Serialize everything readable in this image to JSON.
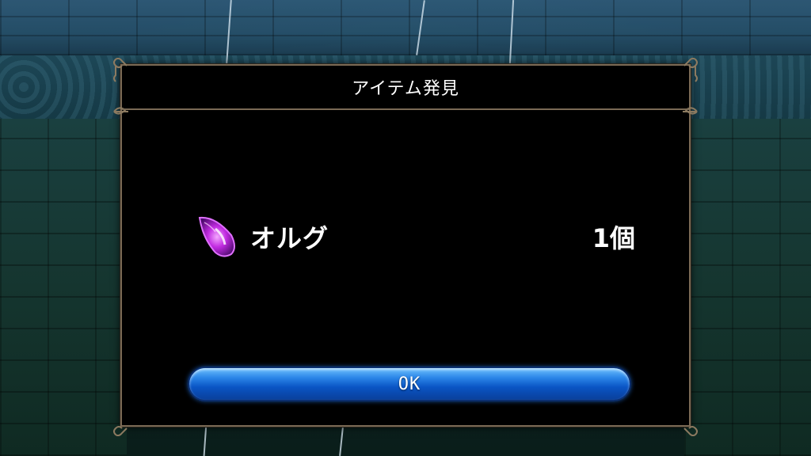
{
  "dialog": {
    "title": "アイテム発見",
    "item": {
      "icon": "purple-crystal-shard-icon",
      "name": "オルグ",
      "count": "1個"
    },
    "ok_label": "OK"
  },
  "colors": {
    "frame": "#7a6a55",
    "button": "#0a55c4",
    "crystal": "#b020d8"
  }
}
